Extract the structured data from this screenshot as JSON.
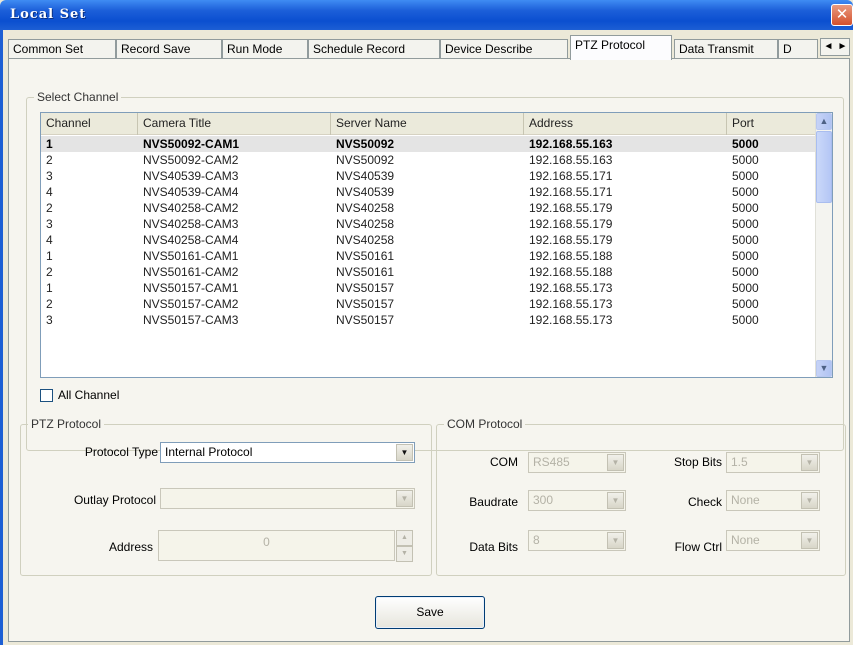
{
  "window": {
    "title": "Local Set",
    "close_glyph": "✕"
  },
  "tabs": [
    {
      "label": "Common Set"
    },
    {
      "label": "Record Save"
    },
    {
      "label": "Run Mode"
    },
    {
      "label": "Schedule Record"
    },
    {
      "label": "Device Describe"
    },
    {
      "label": "PTZ Protocol",
      "active": true
    },
    {
      "label": "Data Transmit"
    },
    {
      "label": "D"
    }
  ],
  "tab_scroll": {
    "left": "◄",
    "right": "►"
  },
  "select_channel": {
    "legend": "Select Channel",
    "columns": [
      "Channel",
      "Camera Title",
      "Server Name",
      "Address",
      "Port"
    ],
    "rows": [
      [
        "1",
        "NVS50092-CAM1",
        "NVS50092",
        "192.168.55.163",
        "5000"
      ],
      [
        "2",
        "NVS50092-CAM2",
        "NVS50092",
        "192.168.55.163",
        "5000"
      ],
      [
        "3",
        "NVS40539-CAM3",
        "NVS40539",
        "192.168.55.171",
        "5000"
      ],
      [
        "4",
        "NVS40539-CAM4",
        "NVS40539",
        "192.168.55.171",
        "5000"
      ],
      [
        "2",
        "NVS40258-CAM2",
        "NVS40258",
        "192.168.55.179",
        "5000"
      ],
      [
        "3",
        "NVS40258-CAM3",
        "NVS40258",
        "192.168.55.179",
        "5000"
      ],
      [
        "4",
        "NVS40258-CAM4",
        "NVS40258",
        "192.168.55.179",
        "5000"
      ],
      [
        "1",
        "NVS50161-CAM1",
        "NVS50161",
        "192.168.55.188",
        "5000"
      ],
      [
        "2",
        "NVS50161-CAM2",
        "NVS50161",
        "192.168.55.188",
        "5000"
      ],
      [
        "1",
        "NVS50157-CAM1",
        "NVS50157",
        "192.168.55.173",
        "5000"
      ],
      [
        "2",
        "NVS50157-CAM2",
        "NVS50157",
        "192.168.55.173",
        "5000"
      ],
      [
        "3",
        "NVS50157-CAM3",
        "NVS50157",
        "192.168.55.173",
        "5000"
      ]
    ],
    "selected_row": 0,
    "scroll_up": "▲",
    "scroll_down": "▼",
    "all_channel_label": "All Channel",
    "all_channel_checked": false
  },
  "ptz_protocol": {
    "legend": "PTZ Protocol",
    "protocol_type_label": "Protocol Type",
    "protocol_type_value": "Internal Protocol",
    "outlay_protocol_label": "Outlay Protocol",
    "outlay_protocol_value": "",
    "address_label": "Address",
    "address_value": "0"
  },
  "com_protocol": {
    "legend": "COM Protocol",
    "com_label": "COM",
    "com_value": "RS485",
    "baudrate_label": "Baudrate",
    "baudrate_value": "300",
    "data_bits_label": "Data Bits",
    "data_bits_value": "8",
    "stop_bits_label": "Stop Bits",
    "stop_bits_value": "1.5",
    "check_label": "Check",
    "check_value": "None",
    "flow_ctrl_label": "Flow Ctrl",
    "flow_ctrl_value": "None"
  },
  "actions": {
    "save_label": "Save"
  },
  "glyphs": {
    "combo_arrow": "▼",
    "spin_up": "▲",
    "spin_down": "▼"
  }
}
